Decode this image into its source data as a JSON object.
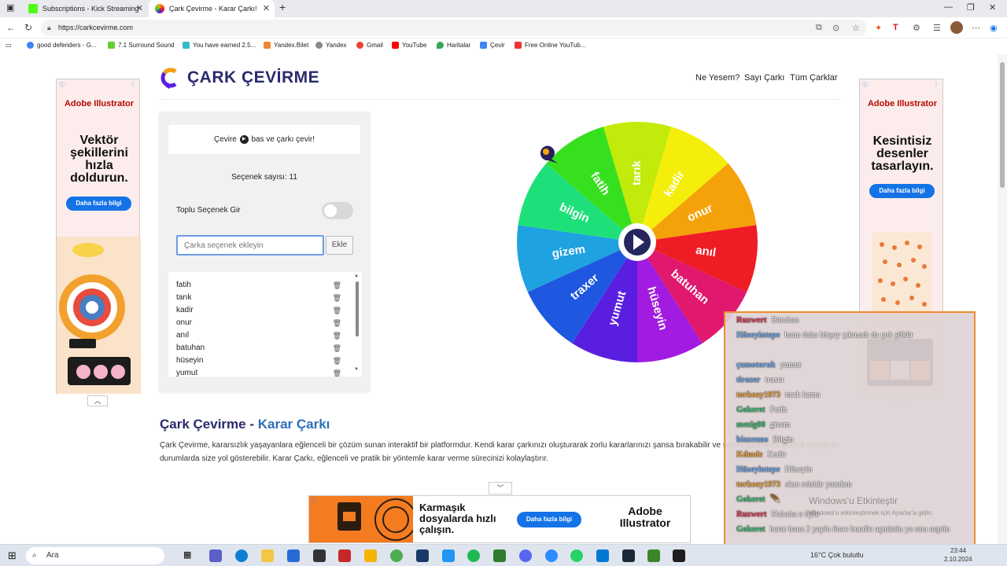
{
  "browser": {
    "tabs": [
      {
        "title": "Subscriptions - Kick Streaming",
        "active": false
      },
      {
        "title": "Çark Çevirme - Karar Çarkı!",
        "active": true
      }
    ],
    "url": "https://carkcevirme.com",
    "bookmarks": [
      "good defenders - G...",
      "7.1 Surround Sound",
      "You have earned 2.5...",
      "Yandex.Bilet",
      "Yandex",
      "Gmail",
      "YouTube",
      "Haritalar",
      "Çevir",
      "Free Online YouTub..."
    ]
  },
  "site": {
    "title": "ÇARK ÇEVİRME",
    "nav": [
      "Ne Yesem?",
      "Sayı Çarkı",
      "Tüm Çarklar"
    ]
  },
  "panel": {
    "hint_before": "Çevire",
    "hint_after": "bas ve çarkı çevir!",
    "count_label": "Seçenek sayısı: 11",
    "bulk_label": "Toplu Seçenek Gir",
    "input_placeholder": "Çarka seçenek ekleyin",
    "add_label": "Ekle",
    "options": [
      "fatih",
      "tarık",
      "kadir",
      "onur",
      "anıl",
      "batuhan",
      "hüseyin",
      "yumut"
    ]
  },
  "wheel": {
    "segments": [
      {
        "label": "tarık",
        "color": "#c2ea0a"
      },
      {
        "label": "kadir",
        "color": "#f5ee0a"
      },
      {
        "label": "onur",
        "color": "#f5a20a"
      },
      {
        "label": "anıl",
        "color": "#ee1c25"
      },
      {
        "label": "batuhan",
        "color": "#e0186e"
      },
      {
        "label": "hüseyin",
        "color": "#a21be0"
      },
      {
        "label": "yumut",
        "color": "#5a1ee0"
      },
      {
        "label": "traxer",
        "color": "#1e58e0"
      },
      {
        "label": "gizem",
        "color": "#1ea2e0"
      },
      {
        "label": "bilgin",
        "color": "#1ee07a"
      },
      {
        "label": "fatih",
        "color": "#37e01e"
      }
    ]
  },
  "article": {
    "title_part1": "Çark Çevirme - ",
    "title_part2": "Karar Çarkı",
    "body": "Çark Çevirme, kararsızlık yaşayanlara eğlenceli bir çözüm sunan interaktif bir platformdur. Kendi karar çarkınızı oluşturarak zorlu kararlarınızı şansa bırakabilir ve seçim yapmakta güçlük çektiğiniz durumlarda size yol gösterebilir. Karar Çarkı, eğlenceli ve pratik bir yöntemle karar verme sürecinizi kolaylaştırır."
  },
  "ads": {
    "left": {
      "brand": "Adobe Illustrator",
      "headline": "Vektör şekillerini hızla doldurun.",
      "cta": "Daha fazla bilgi"
    },
    "right": {
      "brand": "Adobe Illustrator",
      "headline": "Kesintisiz desenler tasarlayın.",
      "cta": "Daha fazla bilgi"
    },
    "bottom": {
      "headline": "Karmaşık dosyalarda hızlı çalışın.",
      "cta": "Daha fazla bilgi",
      "brand": "Adobe Illustrator"
    }
  },
  "chat": {
    "lines": [
      {
        "user": "Ruzwert",
        "msg": "Batuhan",
        "color": "#e03a5a"
      },
      {
        "user": "Hüseyintepe",
        "msg": "bana daha birşey çıkmadı da çok şükür",
        "color": "#6aa8f0"
      },
      {
        "user": "çumotoruk",
        "msg": "yumut",
        "color": "#6aa8f0"
      },
      {
        "user": "tirazer",
        "msg": "traxer",
        "color": "#6aa8f0"
      },
      {
        "user": "torkoay1973",
        "msg": "tarık kama",
        "color": "#f0a43a"
      },
      {
        "user": "Gokeret",
        "msg": "Fatih",
        "color": "#3ac070"
      },
      {
        "user": "mezig00",
        "msg": "gizem",
        "color": "#3ac070"
      },
      {
        "user": "biazenno",
        "msg": "Bilgin",
        "color": "#6aa8f0"
      },
      {
        "user": "Kdmde",
        "msg": "Kadir",
        "color": "#f0a43a"
      },
      {
        "user": "Hüseyintepe",
        "msg": "Hüseyin",
        "color": "#6aa8f0"
      },
      {
        "user": "torkoay1973",
        "msg": "akın reiside yazalım",
        "color": "#f0a43a"
      },
      {
        "user": "Gokeret",
        "msg": "🪶",
        "color": "#3ac070"
      },
      {
        "user": "Ruzwert",
        "msg": "Hahaha o öyle",
        "color": "#e03a5a"
      },
      {
        "user": "Gokeret",
        "msg": "berat bana 2 yayin önce bundle açmistin ya onu naptin",
        "color": "#3ac070"
      }
    ],
    "watermark_title": "Windows'u Etkinleştir",
    "watermark_sub": "Windows'u etkinleştirmek için Ayarlar'a gidin."
  },
  "taskbar": {
    "search_label": "Ara",
    "weather": "16°C  Çok bulutlu",
    "time": "23:44",
    "date": "2.10.2024"
  }
}
